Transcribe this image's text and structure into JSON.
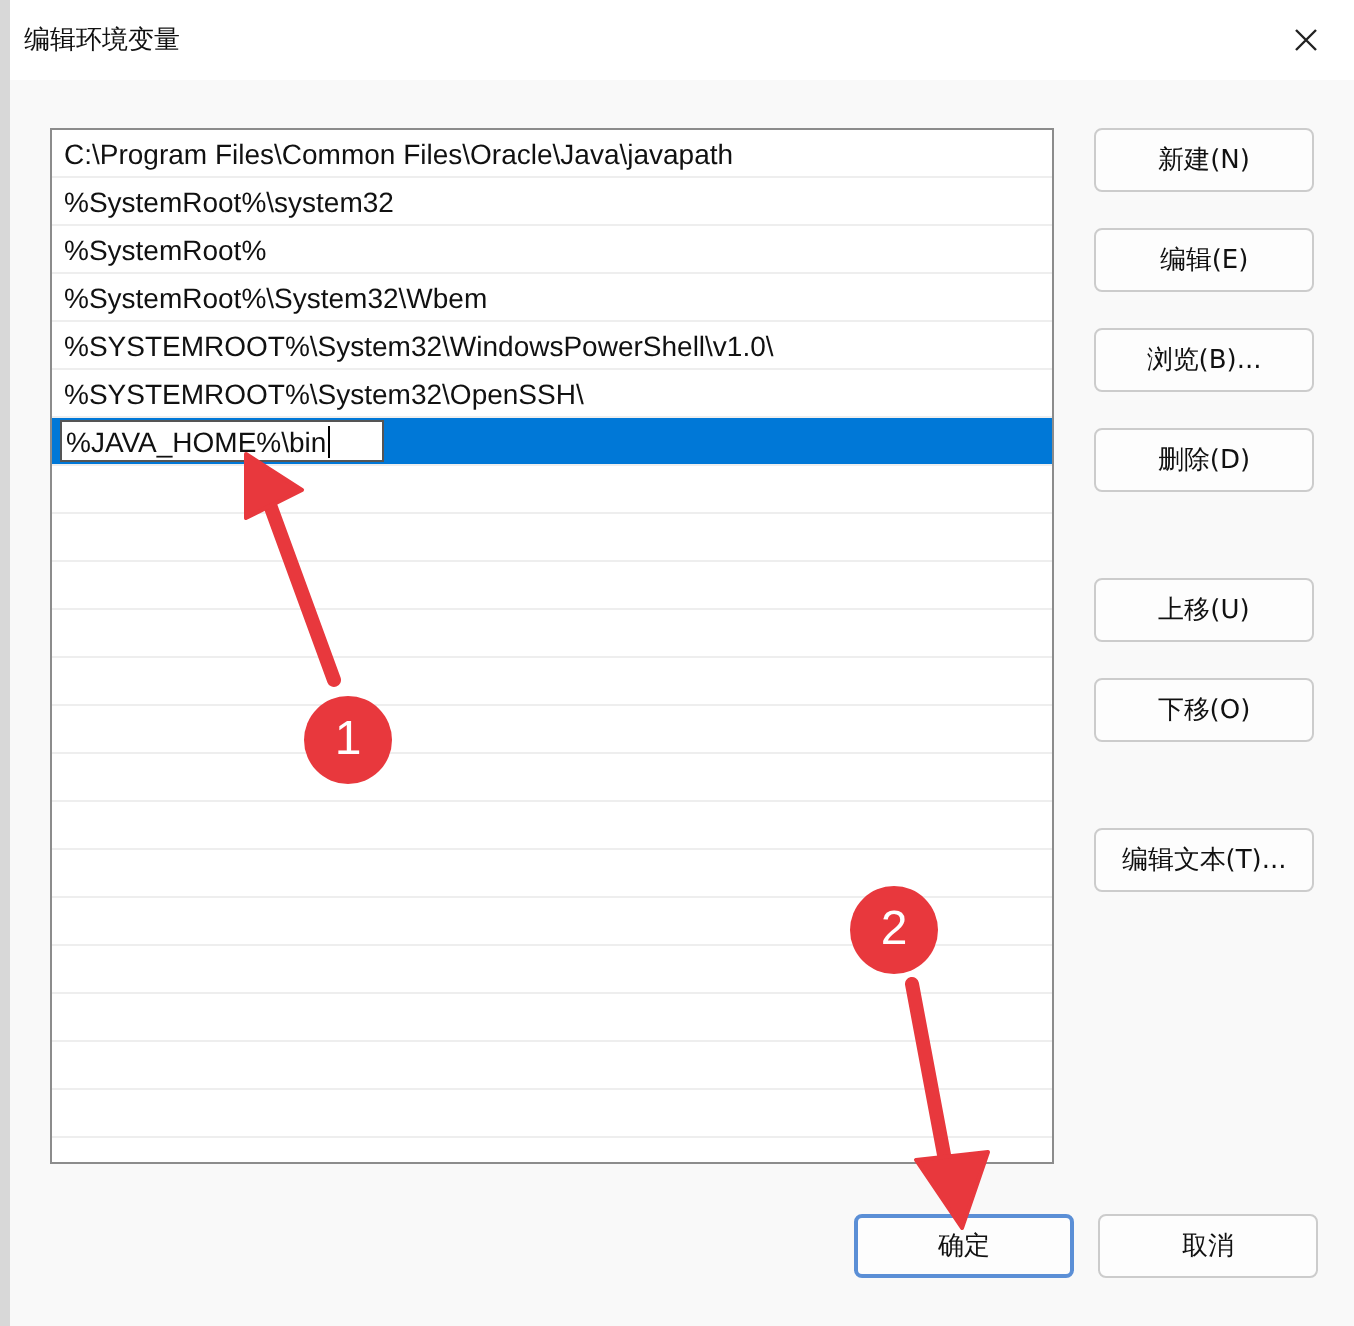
{
  "window": {
    "title": "编辑环境变量"
  },
  "entries": [
    {
      "text": "C:\\Program Files\\Common Files\\Oracle\\Java\\javapath",
      "selected": false
    },
    {
      "text": "%SystemRoot%\\system32",
      "selected": false
    },
    {
      "text": "%SystemRoot%",
      "selected": false
    },
    {
      "text": "%SystemRoot%\\System32\\Wbem",
      "selected": false
    },
    {
      "text": "%SYSTEMROOT%\\System32\\WindowsPowerShell\\v1.0\\",
      "selected": false
    },
    {
      "text": "%SYSTEMROOT%\\System32\\OpenSSH\\",
      "selected": false
    },
    {
      "text": "%JAVA_HOME%\\bin",
      "selected": true
    }
  ],
  "side_buttons": [
    {
      "label": "新建(N)"
    },
    {
      "label": "编辑(E)"
    },
    {
      "label": "浏览(B)..."
    },
    {
      "label": "删除(D)"
    },
    {
      "label": "上移(U)",
      "gap": true
    },
    {
      "label": "下移(O)"
    },
    {
      "label": "编辑文本(T)...",
      "gap": true
    }
  ],
  "footer_buttons": [
    {
      "label": "确定",
      "default": true
    },
    {
      "label": "取消",
      "default": false
    }
  ],
  "annotations": [
    {
      "label": "1"
    },
    {
      "label": "2"
    }
  ]
}
